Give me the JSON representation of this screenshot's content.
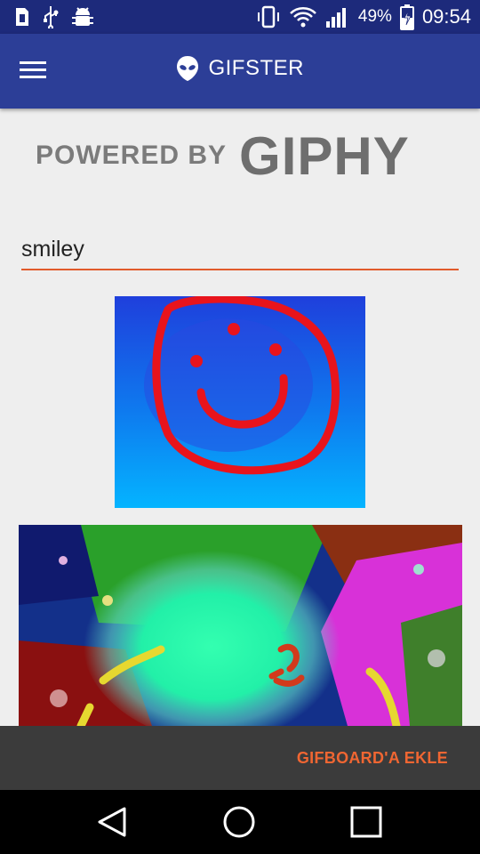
{
  "status_bar": {
    "battery_percent": "49%",
    "time": "09:54",
    "icons": [
      "sim-icon",
      "usb-icon",
      "android-debug-icon",
      "vibrate-icon",
      "wifi-icon",
      "signal-icon",
      "battery-charging-icon"
    ]
  },
  "toolbar": {
    "title": "GIFSTER",
    "menu_icon": "hamburger-menu-icon",
    "logo_icon": "alien-head-icon"
  },
  "banner": {
    "powered_by": "POWERED BY",
    "brand": "GIPHY"
  },
  "search": {
    "value": "smiley"
  },
  "results": {
    "gifs": [
      "smiley-face-gif",
      "abstract-smiley-gif"
    ]
  },
  "action_bar": {
    "add_label": "GIFBOARD'A EKLE"
  },
  "nav_bar": {
    "icons": [
      "back-icon",
      "home-icon",
      "recents-icon"
    ]
  },
  "colors": {
    "status_bar": "#1d2a7b",
    "toolbar": "#2c3e97",
    "accent": "#e15a2b",
    "action_bar": "#3b3b3b",
    "background": "#eeeeee"
  }
}
